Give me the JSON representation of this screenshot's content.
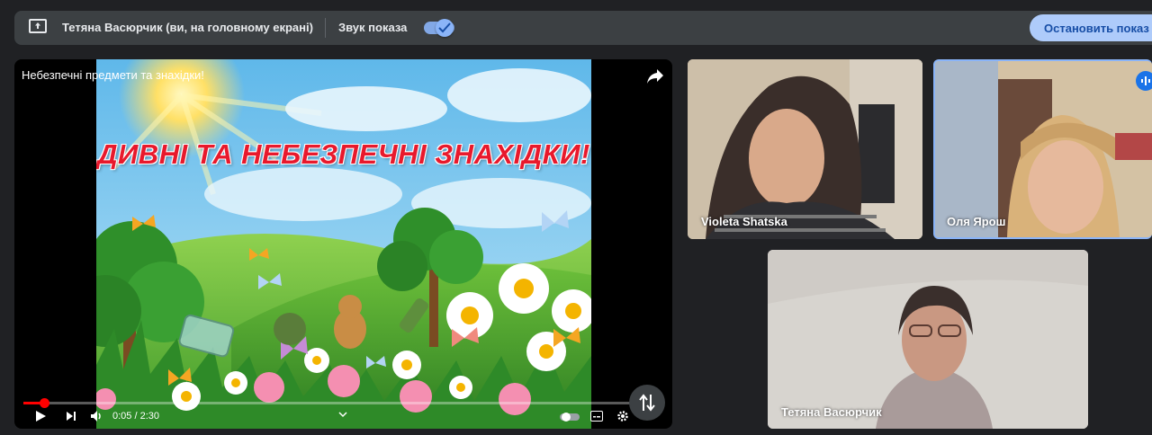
{
  "topbar": {
    "presenter_label": "Тетяна Васюрчик (ви, на головному екрані)",
    "sound_label": "Звук показа",
    "sound_enabled": true,
    "stop_button_label": "Остановить показ"
  },
  "video": {
    "title": "Небезпечні предмети та знахідки!",
    "banner_text": "ДИВНІ ТА НЕБЕЗПЕЧНІ ЗНАХІДКИ!",
    "time_display": "0:05 / 2:30",
    "progress": 0.033
  },
  "participants": [
    {
      "name": "Violeta Shatska"
    },
    {
      "name": "Оля Ярош",
      "speaking": true
    },
    {
      "name": "Тетяна Васюрчик"
    }
  ],
  "colors": {
    "accent": "#8ab4f8",
    "stop_button_bg": "#aecbfa",
    "stop_button_text": "#174ea6",
    "banner_red": "#e8192c",
    "progress_red": "#ff0000"
  }
}
